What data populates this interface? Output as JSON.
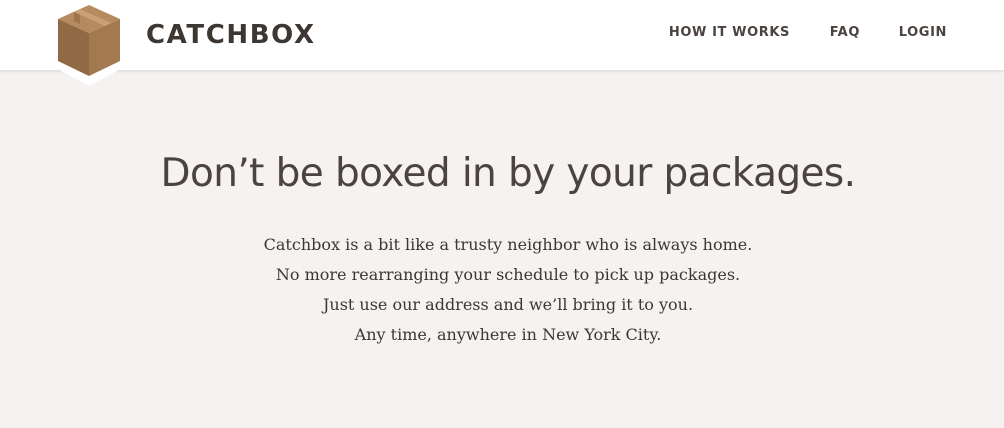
{
  "header": {
    "brand": "CATCHBOX",
    "nav": {
      "how_it_works": "HOW IT WORKS",
      "faq": "FAQ",
      "login": "LOGIN"
    }
  },
  "hero": {
    "headline": "Don’t be boxed in by your packages.",
    "lines": [
      "Catchbox is a bit like a trusty neighbor who is always home.",
      "No more rearranging your schedule to pick up packages.",
      "Just use our address and we’ll bring it to you.",
      "Any time, anywhere in New York City."
    ]
  },
  "colors": {
    "page_background": "#f5f2f1",
    "header_background": "#ffffff",
    "text": "#4a4340",
    "box_top": "#b58a5e",
    "box_left": "#8f6a45",
    "box_right": "#a37a50"
  },
  "icons": {
    "logo": "cardboard-box-icon"
  }
}
